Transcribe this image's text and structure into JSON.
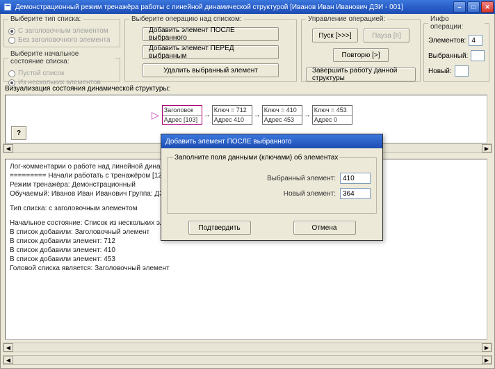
{
  "window": {
    "title": "Демонстрационный режим тренажёра работы с линейной динамической структурой [Иванов Иван Иванович ДЗИ - 001]"
  },
  "group_list_type": {
    "legend": "Выберите тип списка:",
    "opt_header": "С заголовочным элементом",
    "opt_no_header": "Без заголовочного элемента"
  },
  "group_initial_state": {
    "legend": "Выберите начальное состояние списка:",
    "opt_empty": "Пустой список",
    "opt_several": "Из нескольких элементов"
  },
  "group_ops": {
    "legend": "Выберите операцию над списком:",
    "btn_add_after": "Добавить элемент ПОСЛЕ выбранного",
    "btn_add_before": "Добавить элемент ПЕРЕД выбранным",
    "btn_delete": "Удалить выбранный элемент"
  },
  "group_control": {
    "legend": "Управление операцией:",
    "btn_start": "Пуск [>>>]",
    "btn_pause": "Пауза [II]",
    "btn_repeat": "Повторю [>]",
    "btn_finish": "Завершить работу данной структуры"
  },
  "group_info": {
    "legend": "Инфо операции:",
    "lbl_elements": "Элементов:",
    "val_elements": "4",
    "lbl_chosen": "Выбранный:",
    "val_chosen": "",
    "lbl_new": "Новый:",
    "val_new": ""
  },
  "vis": {
    "legend": "Визуализация состояния динамической структуры:",
    "help_q": "?",
    "nodes": [
      {
        "l1": "Заголовок",
        "l2": "Адрес [103]"
      },
      {
        "l1": "Ключ = 712",
        "l2": "Адрес 410"
      },
      {
        "l1": "Ключ = 410",
        "l2": "Адрес 453"
      },
      {
        "l1": "Ключ = 453",
        "l2": "Адрес 0"
      }
    ]
  },
  "log": {
    "header": "Лог-комментарии о работе над линейной динамической структурой",
    "sep": "=========",
    "line_start": "Начали работать с тренажёром [12.7.20",
    "line_mode": "Режим тренажёра: Демонстрационный",
    "line_student": "Обучаемый: Иванов Иван Иванович  Группа: ДЗИ - 0",
    "line_type": "Тип списка: с заголовочным элементом",
    "line_init": "Начальное состояние: Список из нескольких элементов",
    "line_add_hdr": "В список добавили: Заголовочный элемент",
    "line_add1": "В список добавили элемент: 712",
    "line_add2": "В список добавили элемент: 410",
    "line_add3": "В список добавили элемент: 453",
    "line_head": "Головой списка является: Заголовочный элемент"
  },
  "modal": {
    "title": "Добавить элемент ПОСЛЕ выбранного",
    "group_legend": "Заполните поля данными (ключами) об элементах",
    "lbl_chosen": "Выбранный элемент:",
    "val_chosen": "410",
    "lbl_new": "Новый элемент:",
    "val_new": "364",
    "btn_ok": "Подтвердить",
    "btn_cancel": "Отмена"
  }
}
